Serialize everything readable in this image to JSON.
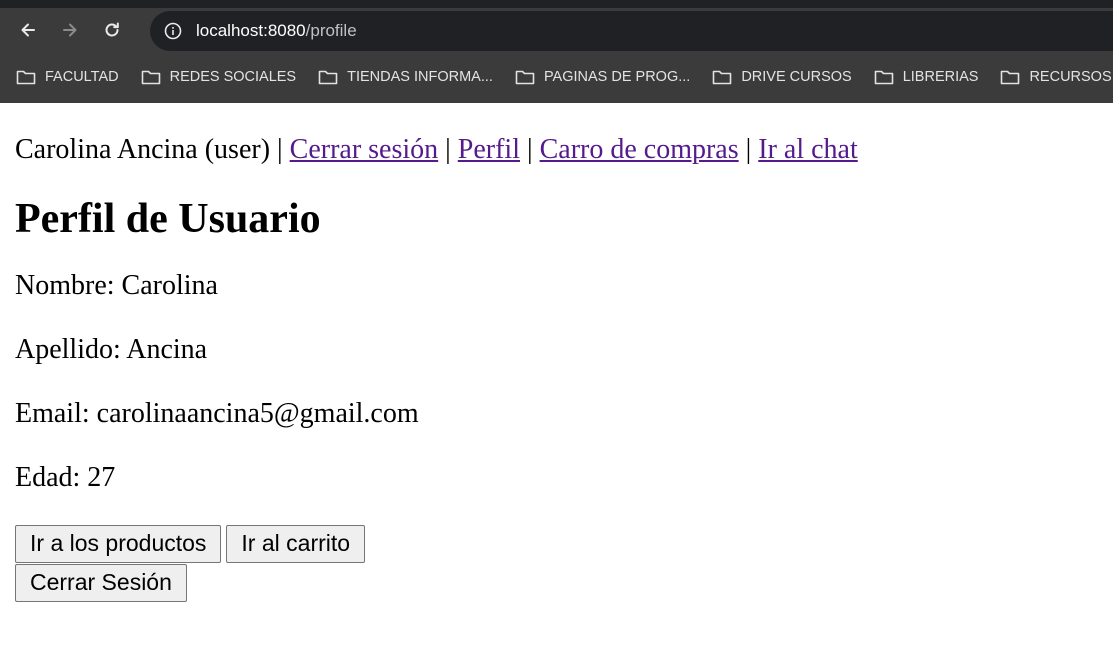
{
  "browser": {
    "url_host": "localhost:8080",
    "url_path": "/profile",
    "bookmarks": [
      {
        "label": "FACULTAD"
      },
      {
        "label": "REDES SOCIALES"
      },
      {
        "label": "TIENDAS INFORMA..."
      },
      {
        "label": "PAGINAS DE PROG..."
      },
      {
        "label": "DRIVE CURSOS"
      },
      {
        "label": "LIBRERIAS"
      },
      {
        "label": "RECURSOS WEB"
      }
    ]
  },
  "nav": {
    "user": "Carolina Ancina (user)",
    "separator": "|",
    "logout_link": "Cerrar sesión",
    "profile_link": "Perfil",
    "cart_link": "Carro de compras",
    "chat_link": "Ir al chat"
  },
  "profile": {
    "title": "Perfil de Usuario",
    "nombre": "Nombre: Carolina",
    "apellido": "Apellido: Ancina",
    "email": "Email: carolinaancina5@gmail.com",
    "edad": "Edad: 27"
  },
  "buttons": {
    "products": "Ir a los productos",
    "cart": "Ir al carrito",
    "logout": "Cerrar Sesión"
  }
}
